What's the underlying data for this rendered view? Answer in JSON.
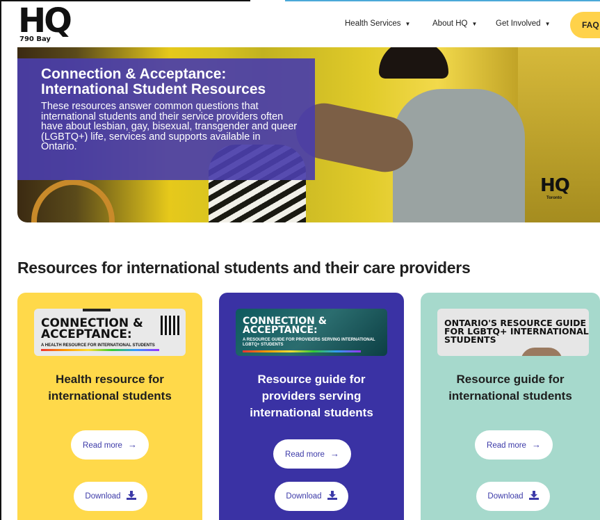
{
  "header": {
    "logo": {
      "brand": "HQ",
      "subtitle": "790 Bay"
    },
    "nav": [
      {
        "label": "Health Services",
        "has_dropdown": true
      },
      {
        "label": "About HQ",
        "has_dropdown": true
      },
      {
        "label": "Get Involved",
        "has_dropdown": true
      }
    ],
    "faq_label": "FAQ"
  },
  "hero": {
    "title": "Connection & Acceptance: International Student Resources",
    "description": "These resources answer common questions that international students and their service providers often have about lesbian, gay, bisexual, transgender and queer (LGBTQ+) life, services and supports available in Ontario.",
    "watermark": {
      "brand": "HQ",
      "city": "Toronto"
    }
  },
  "section": {
    "title": "Resources for international students and their care providers"
  },
  "cards": [
    {
      "thumbnail": {
        "heading": "CONNECTION & ACCEPTANCE:",
        "subheading": "A HEALTH RESOURCE FOR INTERNATIONAL STUDENTS"
      },
      "title": "Health resource for international students",
      "read_more_label": "Read more",
      "download_label": "Download",
      "color": "#ffd94a"
    },
    {
      "thumbnail": {
        "heading": "CONNECTION & ACCEPTANCE:",
        "subheading": "A RESOURCE GUIDE FOR PROVIDERS SERVING INTERNATIONAL LGBTQ+ STUDENTS"
      },
      "title": "Resource guide for providers serving international students",
      "read_more_label": "Read more",
      "download_label": "Download",
      "color": "#3a32a4"
    },
    {
      "thumbnail": {
        "heading": "ONTARIO'S RESOURCE GUIDE FOR LGBTQ+ INTERNATIONAL STUDENTS",
        "subheading": ""
      },
      "title": "Resource guide for international students",
      "read_more_label": "Read more",
      "download_label": "Download",
      "color": "#a6d9cc"
    }
  ],
  "icons": {
    "arrow": "arrow-right-icon",
    "download": "download-icon",
    "caret": "chevron-down-icon"
  },
  "colors": {
    "accent_purple": "#3c3aa8",
    "faq_yellow": "#ffd24a"
  }
}
